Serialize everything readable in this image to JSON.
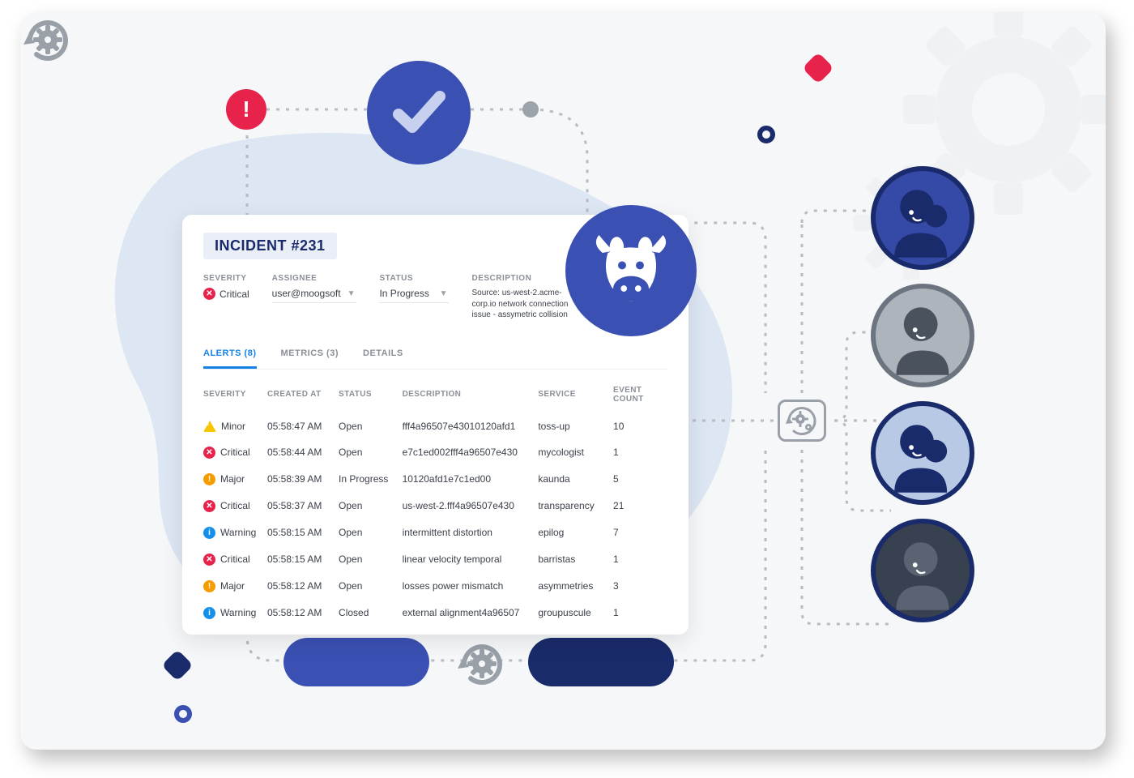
{
  "colors": {
    "blue": "#3a50b3",
    "navy": "#1a2b6b",
    "gray": "#9aa0a8",
    "red": "#e7234c",
    "orange": "#f59c00",
    "amber": "#f7c600",
    "info": "#1590ea",
    "link": "#1682e5"
  },
  "card": {
    "title": "INCIDENT #231",
    "meta": {
      "severity_label": "SEVERITY",
      "severity_value": "Critical",
      "assignee_label": "ASSIGNEE",
      "assignee_value": "user@moogsoft",
      "status_label": "STATUS",
      "status_value": "In Progress",
      "description_label": "DESCRIPTION",
      "description_value": "Source: us-west-2.acme-corp.io network connection issue - assymetric collision"
    },
    "tabs": {
      "alerts": "ALERTS (8)",
      "metrics": "METRICS (3)",
      "details": "DETAILS"
    },
    "columns": {
      "severity": "SEVERITY",
      "created": "CREATED AT",
      "status": "STATUS",
      "description": "DESCRIPTION",
      "service": "SERVICE",
      "count": "EVENT COUNT"
    },
    "rows": [
      {
        "sev": "Minor",
        "sev_kind": "minor",
        "created": "05:58:47 AM",
        "status": "Open",
        "desc": "fff4a96507e43010120afd1",
        "service": "toss-up",
        "count": "10"
      },
      {
        "sev": "Critical",
        "sev_kind": "critical",
        "created": "05:58:44 AM",
        "status": "Open",
        "desc": "e7c1ed002fff4a96507e430",
        "service": "mycologist",
        "count": "1"
      },
      {
        "sev": "Major",
        "sev_kind": "major",
        "created": "05:58:39 AM",
        "status": "In Progress",
        "desc": "10120afd1e7c1ed00",
        "service": "kaunda",
        "count": "5"
      },
      {
        "sev": "Critical",
        "sev_kind": "critical",
        "created": "05:58:37 AM",
        "status": "Open",
        "desc": "us-west-2.fff4a96507e430",
        "service": "transparency",
        "count": "21"
      },
      {
        "sev": "Warning",
        "sev_kind": "warning",
        "created": "05:58:15 AM",
        "status": "Open",
        "desc": "intermittent  distortion",
        "service": "epilog",
        "count": "7"
      },
      {
        "sev": "Critical",
        "sev_kind": "critical",
        "created": "05:58:15 AM",
        "status": "Open",
        "desc": "linear velocity temporal",
        "service": "barristas",
        "count": "1"
      },
      {
        "sev": "Major",
        "sev_kind": "major",
        "created": "05:58:12 AM",
        "status": "Open",
        "desc": "losses power mismatch",
        "service": "asymmetries",
        "count": "3"
      },
      {
        "sev": "Warning",
        "sev_kind": "warning",
        "created": "05:58:12 AM",
        "status": "Closed",
        "desc": "external alignment4a96507",
        "service": "groupuscule",
        "count": "1"
      }
    ]
  },
  "icons": {
    "alert": "alert-icon",
    "gear": "gear-icon",
    "check": "check-icon",
    "cow": "cow-icon",
    "avatar": "avatar-icon"
  }
}
